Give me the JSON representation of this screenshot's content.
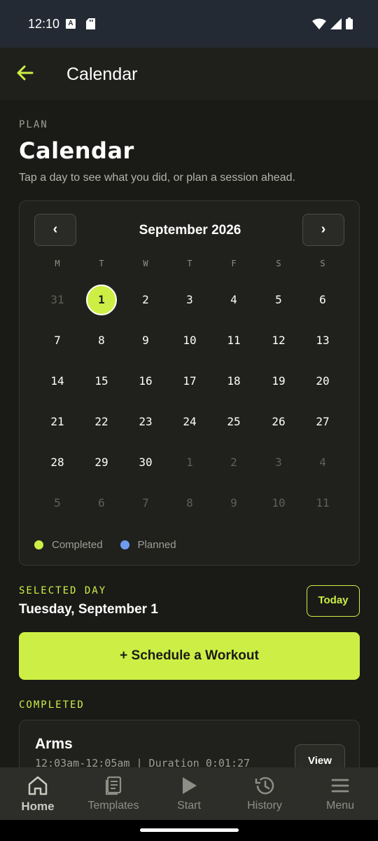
{
  "status_bar": {
    "time": "12:10",
    "a_badge": "A"
  },
  "app_bar": {
    "title": "Calendar"
  },
  "header": {
    "eyebrow": "PLAN",
    "title": "Calendar",
    "subtitle": "Tap a day to see what you did, or plan a session ahead."
  },
  "calendar": {
    "prev_label": "‹",
    "next_label": "›",
    "month": "September 2026",
    "weekdays": [
      "M",
      "T",
      "W",
      "T",
      "F",
      "S",
      "S"
    ],
    "weeks": [
      [
        {
          "d": "31",
          "m": true
        },
        {
          "d": "1",
          "s": true
        },
        {
          "d": "2"
        },
        {
          "d": "3"
        },
        {
          "d": "4"
        },
        {
          "d": "5"
        },
        {
          "d": "6"
        }
      ],
      [
        {
          "d": "7"
        },
        {
          "d": "8"
        },
        {
          "d": "9"
        },
        {
          "d": "10"
        },
        {
          "d": "11"
        },
        {
          "d": "12"
        },
        {
          "d": "13"
        }
      ],
      [
        {
          "d": "14"
        },
        {
          "d": "15"
        },
        {
          "d": "16"
        },
        {
          "d": "17"
        },
        {
          "d": "18"
        },
        {
          "d": "19"
        },
        {
          "d": "20"
        }
      ],
      [
        {
          "d": "21"
        },
        {
          "d": "22"
        },
        {
          "d": "23"
        },
        {
          "d": "24"
        },
        {
          "d": "25"
        },
        {
          "d": "26"
        },
        {
          "d": "27"
        }
      ],
      [
        {
          "d": "28"
        },
        {
          "d": "29"
        },
        {
          "d": "30"
        },
        {
          "d": "1",
          "m": true
        },
        {
          "d": "2",
          "m": true
        },
        {
          "d": "3",
          "m": true
        },
        {
          "d": "4",
          "m": true
        }
      ],
      [
        {
          "d": "5",
          "m": true
        },
        {
          "d": "6",
          "m": true
        },
        {
          "d": "7",
          "m": true
        },
        {
          "d": "8",
          "m": true
        },
        {
          "d": "9",
          "m": true
        },
        {
          "d": "10",
          "m": true
        },
        {
          "d": "11",
          "m": true
        }
      ]
    ],
    "legend": [
      {
        "label": "Completed",
        "color": "#cdef45"
      },
      {
        "label": "Planned",
        "color": "#6f9cf0"
      }
    ]
  },
  "selected_day": {
    "eyebrow": "SELECTED DAY",
    "date": "Tuesday, September 1",
    "today_label": "Today"
  },
  "schedule_button": "+ Schedule a Workout",
  "completed": {
    "eyebrow": "COMPLETED",
    "workouts": [
      {
        "name": "Arms",
        "meta": "12:03am-12:05am | Duration 0:01:27",
        "view_label": "View"
      }
    ]
  },
  "bottom_nav": [
    {
      "label": "Home",
      "icon": "home-icon",
      "active": true
    },
    {
      "label": "Templates",
      "icon": "templates-icon"
    },
    {
      "label": "Start",
      "icon": "play-icon"
    },
    {
      "label": "History",
      "icon": "history-icon"
    },
    {
      "label": "Menu",
      "icon": "menu-icon"
    }
  ],
  "colors": {
    "accent": "#cdef45",
    "background": "#1a1b17",
    "planned": "#6f9cf0"
  }
}
